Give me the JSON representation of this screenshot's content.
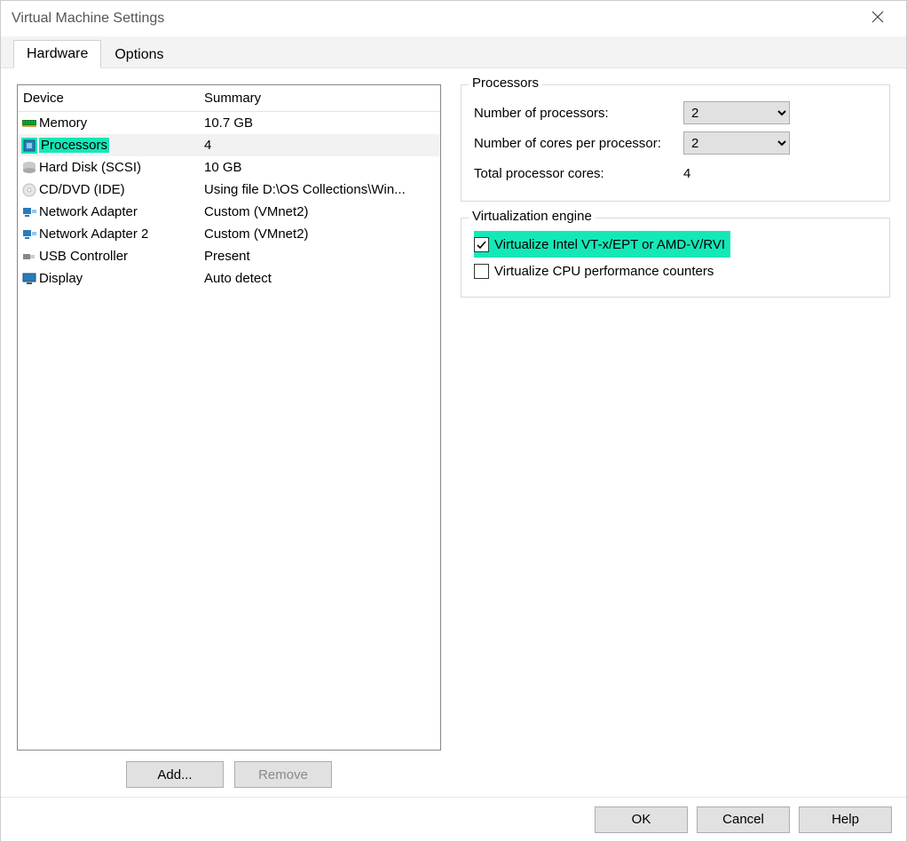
{
  "window": {
    "title": "Virtual Machine Settings"
  },
  "tabs": {
    "hardware": "Hardware",
    "options": "Options"
  },
  "columns": {
    "device": "Device",
    "summary": "Summary"
  },
  "devices": [
    {
      "name": "Memory",
      "summary": "10.7 GB",
      "icon": "memory"
    },
    {
      "name": "Processors",
      "summary": "4",
      "icon": "cpu",
      "selected": true,
      "highlight": true
    },
    {
      "name": "Hard Disk (SCSI)",
      "summary": "10 GB",
      "icon": "hdd"
    },
    {
      "name": "CD/DVD (IDE)",
      "summary": "Using file D:\\OS Collections\\Win...",
      "icon": "cd"
    },
    {
      "name": "Network Adapter",
      "summary": "Custom (VMnet2)",
      "icon": "nic"
    },
    {
      "name": "Network Adapter 2",
      "summary": "Custom (VMnet2)",
      "icon": "nic"
    },
    {
      "name": "USB Controller",
      "summary": "Present",
      "icon": "usb"
    },
    {
      "name": "Display",
      "summary": "Auto detect",
      "icon": "display"
    }
  ],
  "buttons": {
    "add": "Add...",
    "remove": "Remove"
  },
  "processors_group": {
    "legend": "Processors",
    "num_processors_label": "Number of processors:",
    "num_processors_value": "2",
    "cores_label": "Number of cores per processor:",
    "cores_value": "2",
    "total_label": "Total processor cores:",
    "total_value": "4"
  },
  "virt_group": {
    "legend": "Virtualization engine",
    "vt_label": "Virtualize Intel VT-x/EPT or AMD-V/RVI",
    "vt_checked": true,
    "perf_label": "Virtualize CPU performance counters",
    "perf_checked": false
  },
  "footer": {
    "ok": "OK",
    "cancel": "Cancel",
    "help": "Help"
  }
}
